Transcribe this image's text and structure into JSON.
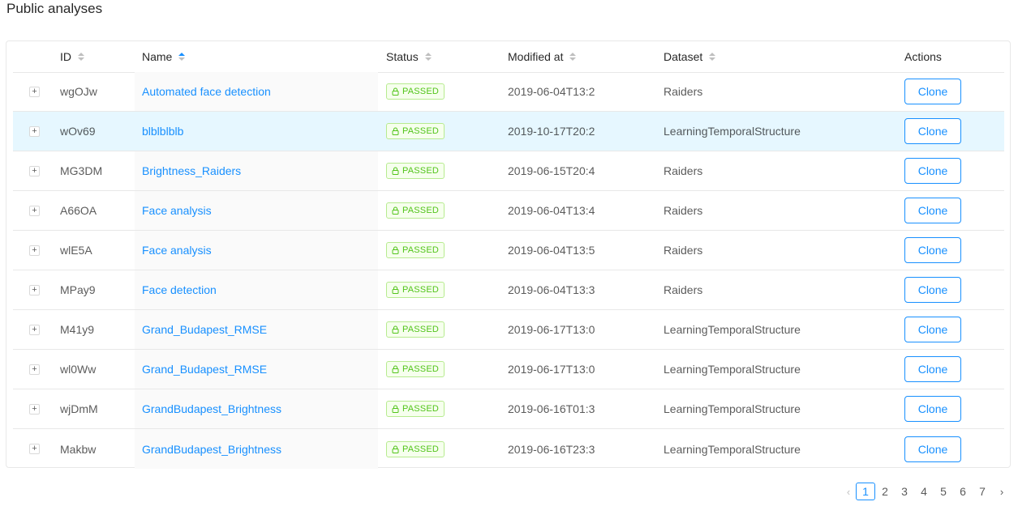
{
  "page_title": "Public analyses",
  "columns": {
    "id": "ID",
    "name": "Name",
    "status": "Status",
    "modified": "Modified at",
    "dataset": "Dataset",
    "actions": "Actions"
  },
  "expand_label": "+",
  "clone_label": "Clone",
  "rows": [
    {
      "id": "wgOJw",
      "name": "Automated face detection",
      "status": "PASSED",
      "modified": "2019-06-04T13:2",
      "dataset": "Raiders"
    },
    {
      "id": "wOv69",
      "name": "blblblblb",
      "status": "PASSED",
      "modified": "2019-10-17T20:2",
      "dataset": "LearningTemporalStructure"
    },
    {
      "id": "MG3DM",
      "name": "Brightness_Raiders",
      "status": "PASSED",
      "modified": "2019-06-15T20:4",
      "dataset": "Raiders"
    },
    {
      "id": "A66OA",
      "name": "Face analysis",
      "status": "PASSED",
      "modified": "2019-06-04T13:4",
      "dataset": "Raiders"
    },
    {
      "id": "wlE5A",
      "name": "Face analysis",
      "status": "PASSED",
      "modified": "2019-06-04T13:5",
      "dataset": "Raiders"
    },
    {
      "id": "MPay9",
      "name": "Face detection",
      "status": "PASSED",
      "modified": "2019-06-04T13:3",
      "dataset": "Raiders"
    },
    {
      "id": "M41y9",
      "name": "Grand_Budapest_RMSE",
      "status": "PASSED",
      "modified": "2019-06-17T13:0",
      "dataset": "LearningTemporalStructure"
    },
    {
      "id": "wl0Ww",
      "name": "Grand_Budapest_RMSE",
      "status": "PASSED",
      "modified": "2019-06-17T13:0",
      "dataset": "LearningTemporalStructure"
    },
    {
      "id": "wjDmM",
      "name": "GrandBudapest_Brightness",
      "status": "PASSED",
      "modified": "2019-06-16T01:3",
      "dataset": "LearningTemporalStructure"
    },
    {
      "id": "Makbw",
      "name": "GrandBudapest_Brightness",
      "status": "PASSED",
      "modified": "2019-06-16T23:3",
      "dataset": "LearningTemporalStructure"
    }
  ],
  "highlighted_row": 1,
  "pagination": {
    "prev": "‹",
    "next": "›",
    "pages": [
      "1",
      "2",
      "3",
      "4",
      "5",
      "6",
      "7"
    ],
    "current": "1"
  },
  "colors": {
    "accent": "#1890ff",
    "passed_text": "#52c41a",
    "passed_bg": "#f6ffed",
    "passed_border": "#b7eb8f",
    "row_highlight": "#e6f7ff"
  },
  "icons": {
    "status_icon": "lock-icon",
    "sort_icon": "sort-caret-icon",
    "expand_icon": "plus-icon"
  }
}
